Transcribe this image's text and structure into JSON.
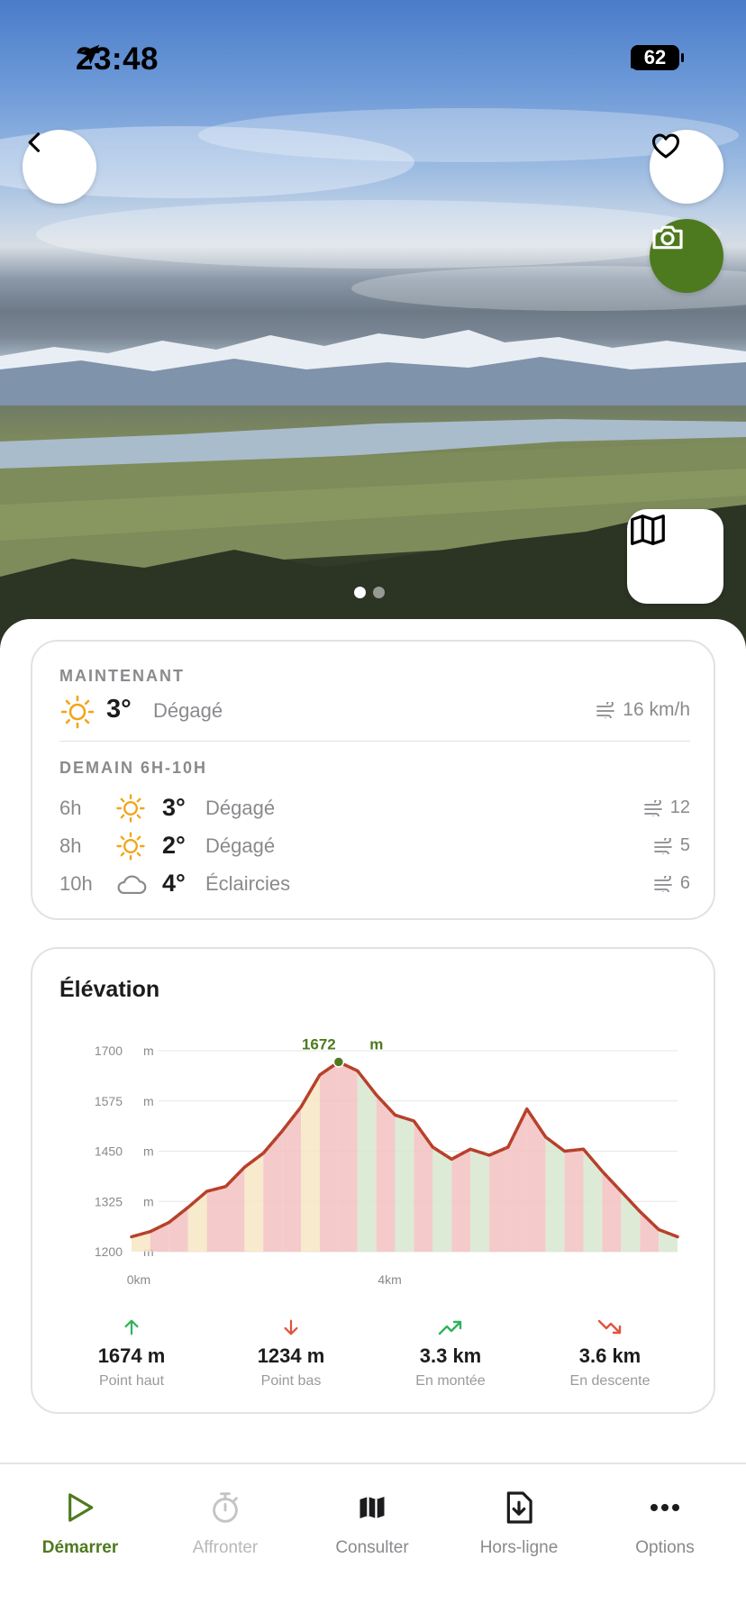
{
  "status_bar": {
    "time": "23:48",
    "battery": "62"
  },
  "hero": {
    "page_indicator": {
      "count": 2,
      "active": 0
    }
  },
  "weather": {
    "now_label": "MAINTENANT",
    "now": {
      "temp": "3°",
      "condition": "Dégagé",
      "wind": "16 km/h",
      "icon": "sun-icon"
    },
    "tomorrow_label": "DEMAIN 6H-10H",
    "hours": [
      {
        "hour": "6h",
        "icon": "sun-icon",
        "temp": "3°",
        "condition": "Dégagé",
        "wind": "12"
      },
      {
        "hour": "8h",
        "icon": "sun-icon",
        "temp": "2°",
        "condition": "Dégagé",
        "wind": "5"
      },
      {
        "hour": "10h",
        "icon": "cloud-icon",
        "temp": "4°",
        "condition": "Éclaircies",
        "wind": "6"
      }
    ]
  },
  "elevation": {
    "title": "Élévation",
    "peak_label": "1672",
    "peak_unit": "m",
    "y_ticks": [
      "1700",
      "1575",
      "1450",
      "1325",
      "1200"
    ],
    "y_unit": "m",
    "x_ticks": [
      "0km",
      "4km"
    ],
    "stats": [
      {
        "value": "1674 m",
        "label": "Point haut",
        "icon": "arrow-up-icon",
        "color": "#2fb35a"
      },
      {
        "value": "1234 m",
        "label": "Point bas",
        "icon": "arrow-down-icon",
        "color": "#e0533c"
      },
      {
        "value": "3.3 km",
        "label": "En montée",
        "icon": "trend-up-icon",
        "color": "#2fb35a"
      },
      {
        "value": "3.6 km",
        "label": "En descente",
        "icon": "trend-down-icon",
        "color": "#e0533c"
      }
    ]
  },
  "chart_data": {
    "type": "area",
    "title": "Élévation",
    "xlabel": "",
    "ylabel": "",
    "ylim": [
      1200,
      1700
    ],
    "x_ticks": [
      "0km",
      "4km"
    ],
    "x_km": [
      0,
      0.3,
      0.6,
      0.9,
      1.2,
      1.5,
      1.8,
      2.1,
      2.4,
      2.7,
      3.0,
      3.3,
      3.6,
      3.9,
      4.2,
      4.5,
      4.8,
      5.1,
      5.4,
      5.7,
      6.0,
      6.3,
      6.6,
      6.9,
      7.2,
      7.5,
      7.8,
      8.1,
      8.4,
      8.7
    ],
    "elevation_m": [
      1237,
      1250,
      1273,
      1310,
      1350,
      1362,
      1410,
      1445,
      1500,
      1560,
      1640,
      1672,
      1650,
      1590,
      1540,
      1525,
      1460,
      1430,
      1455,
      1440,
      1460,
      1555,
      1485,
      1450,
      1455,
      1400,
      1350,
      1300,
      1255,
      1237
    ],
    "peak": {
      "x_km": 3.3,
      "elevation_m": 1672,
      "label": "1672 m"
    },
    "colors": {
      "line_climb": "#c0392b",
      "line_flat": "#5a8a2a",
      "fill_red": "#f3c1c1",
      "fill_green": "#d7e8cf",
      "fill_yellow": "#f6e6c4",
      "peak_marker": "#4e7a1f"
    }
  },
  "bottom_nav": [
    {
      "label": "Démarrer",
      "icon": "play-icon",
      "state": "active"
    },
    {
      "label": "Affronter",
      "icon": "stopwatch-icon",
      "state": "disabled"
    },
    {
      "label": "Consulter",
      "icon": "map-icon",
      "state": "normal"
    },
    {
      "label": "Hors-ligne",
      "icon": "download-file-icon",
      "state": "normal"
    },
    {
      "label": "Options",
      "icon": "more-icon",
      "state": "normal"
    }
  ],
  "colors": {
    "accent": "#4e7a1f",
    "muted": "#8a8a8e",
    "sun": "#f2a51a"
  }
}
